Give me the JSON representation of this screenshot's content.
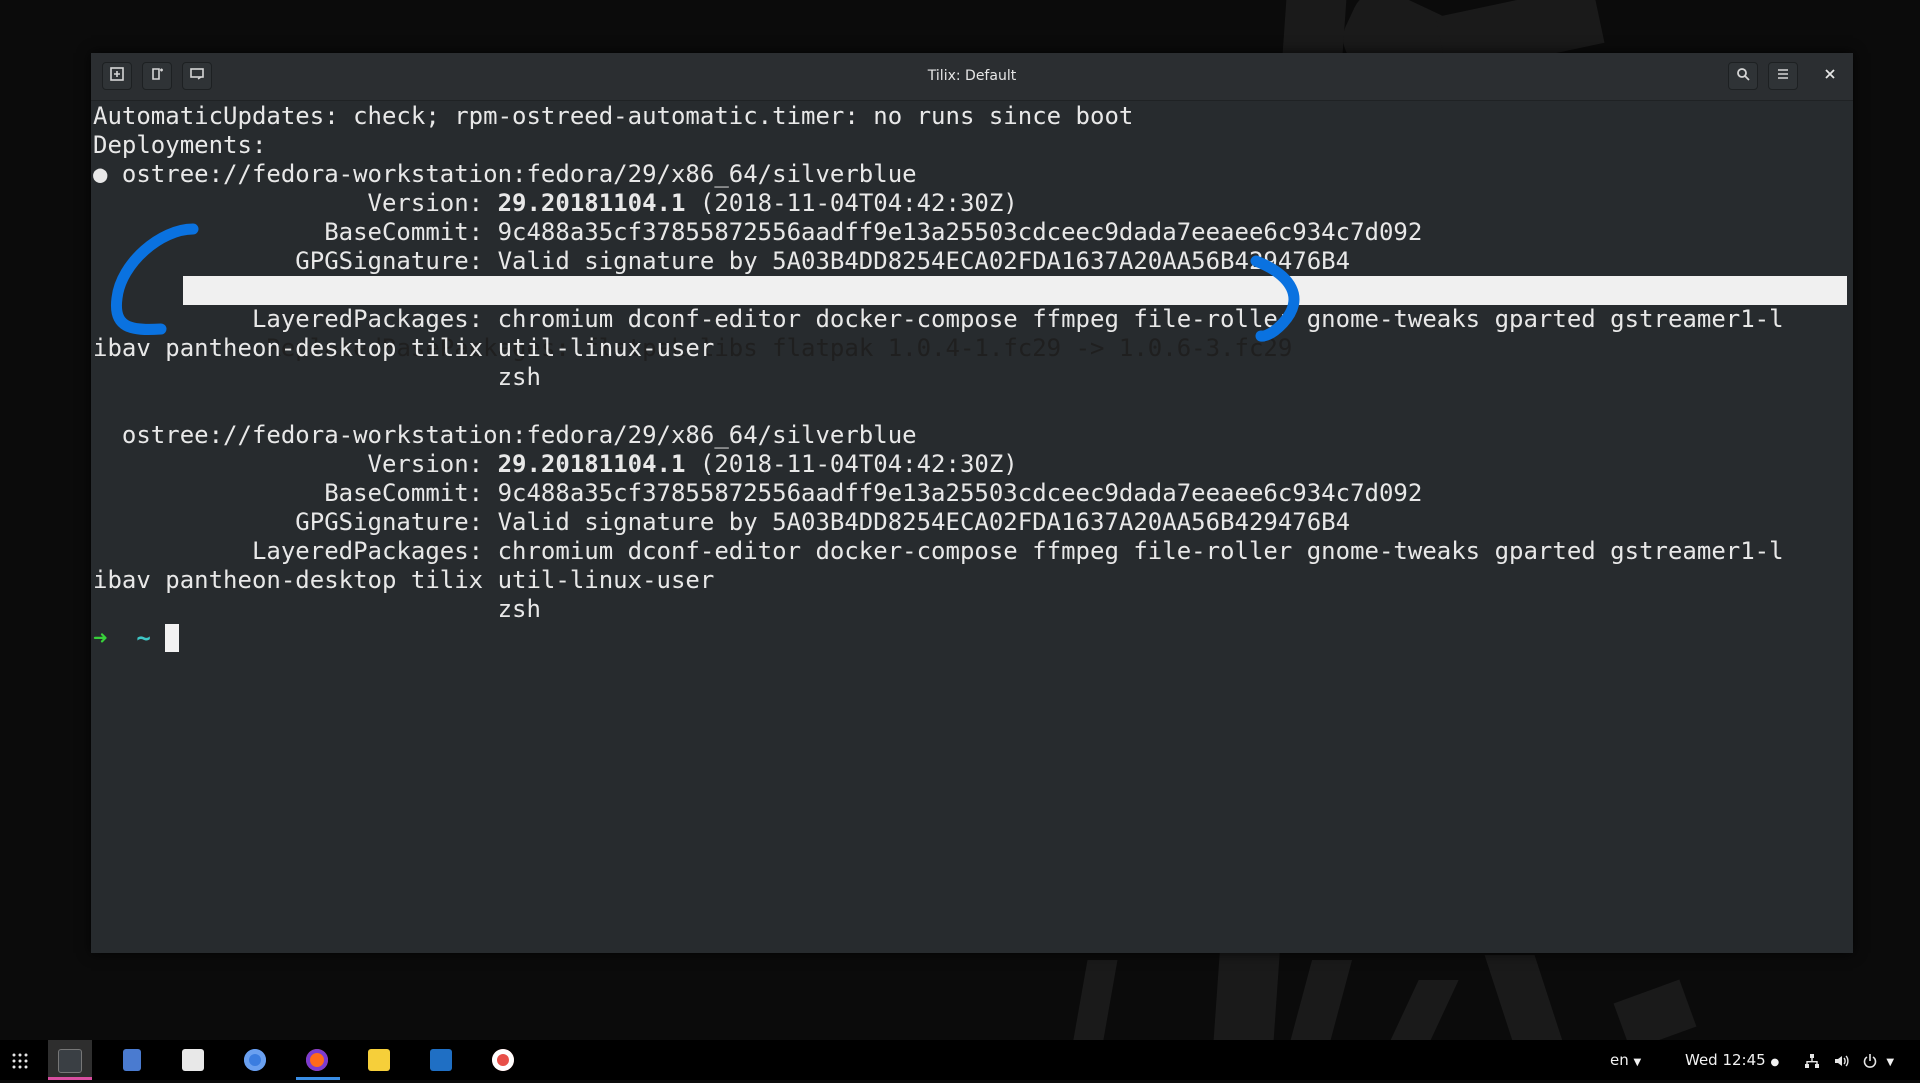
{
  "window": {
    "title": "Tilix: Default",
    "buttons": {
      "add_terminal_right": "⊞",
      "add_terminal_down": "⇩",
      "session_switcher": "▭",
      "search": "⌕",
      "menu": "≡",
      "close": "×"
    }
  },
  "terminal": {
    "lines": [
      "AutomaticUpdates: check; rpm-ostreed-automatic.timer: no runs since boot",
      "Deployments:",
      "● ostree://fedora-workstation:fedora/29/x86_64/silverblue",
      "                   Version: ",
      "                BaseCommit: 9c488a35cf37855872556aadff9e13a25503cdceec9dada7eeaee6c934c7d092",
      "              GPGSignature: Valid signature by 5A03B4DD8254ECA02FDA1637A20AA56B429476B4",
      "      ReplacedBasePackages: flatpak-libs flatpak 1.0.4-1.fc29 -> 1.0.6-3.fc29",
      "           LayeredPackages: chromium dconf-editor docker-compose ffmpeg file-roller gnome-tweaks gparted gstreamer1-l",
      "ibav pantheon-desktop tilix util-linux-user",
      "                            zsh",
      "",
      "  ostree://fedora-workstation:fedora/29/x86_64/silverblue",
      "                   Version: ",
      "                BaseCommit: 9c488a35cf37855872556aadff9e13a25503cdceec9dada7eeaee6c934c7d092",
      "              GPGSignature: Valid signature by 5A03B4DD8254ECA02FDA1637A20AA56B429476B4",
      "           LayeredPackages: chromium dconf-editor docker-compose ffmpeg file-roller gnome-tweaks gparted gstreamer1-l",
      "ibav pantheon-desktop tilix util-linux-user",
      "                            zsh"
    ],
    "version_value": "29.20181104.1",
    "version_date": " (2018-11-04T04:42:30Z)",
    "highlighted_label": "ReplacedBasePackages: flatpak-libs flatpak 1.0.4-1.fc29 -> 1.0.6-3.fc29",
    "prompt": {
      "arrow": "➜",
      "dir": "~"
    }
  },
  "taskbar": {
    "apps": [
      "app-grid",
      "tilix",
      "files",
      "software",
      "chromium",
      "firefox",
      "notes",
      "vscode",
      "ubuntu-like"
    ],
    "language": "en",
    "clock": "Wed 12:45",
    "colors": {
      "firefox_underline": "#3a8ee6",
      "tilix_underline": "#d94ea0",
      "annotation": "#0a72e0"
    }
  }
}
